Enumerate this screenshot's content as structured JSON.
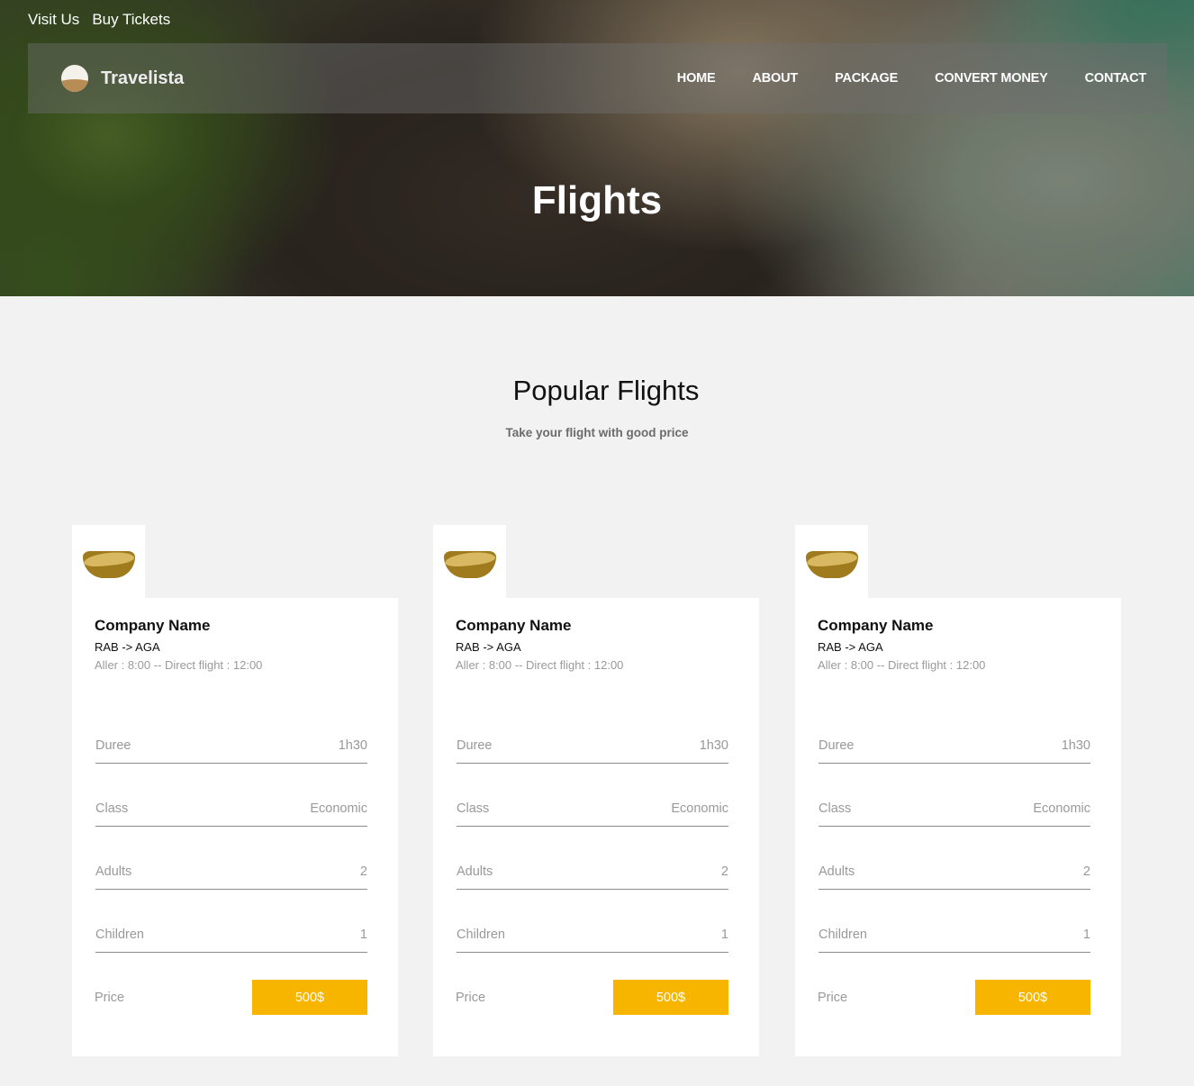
{
  "topbar": {
    "visit": "Visit Us",
    "tickets": "Buy Tickets"
  },
  "brand": {
    "name": "Travelista"
  },
  "nav": [
    "HOME",
    "ABOUT",
    "PACKAGE",
    "CONVERT MONEY",
    "CONTACT"
  ],
  "hero": {
    "title": "Flights"
  },
  "section": {
    "title": "Popular Flights",
    "subtitle": "Take your flight with good price"
  },
  "colors": {
    "accent": "#f8b500",
    "background": "#f2f2f2"
  },
  "cards": [
    {
      "company": "Company Name",
      "route": "RAB -> AGA",
      "times": "Aller : 8:00 -- Direct flight : 12:00",
      "details": [
        {
          "label": "Duree",
          "value": "1h30"
        },
        {
          "label": "Class",
          "value": "Economic"
        },
        {
          "label": "Adults",
          "value": "2"
        },
        {
          "label": "Children",
          "value": "1"
        }
      ],
      "price_label": "Price",
      "price": "500$"
    },
    {
      "company": "Company Name",
      "route": "RAB -> AGA",
      "times": "Aller : 8:00 -- Direct flight : 12:00",
      "details": [
        {
          "label": "Duree",
          "value": "1h30"
        },
        {
          "label": "Class",
          "value": "Economic"
        },
        {
          "label": "Adults",
          "value": "2"
        },
        {
          "label": "Children",
          "value": "1"
        }
      ],
      "price_label": "Price",
      "price": "500$"
    },
    {
      "company": "Company Name",
      "route": "RAB -> AGA",
      "times": "Aller : 8:00 -- Direct flight : 12:00",
      "details": [
        {
          "label": "Duree",
          "value": "1h30"
        },
        {
          "label": "Class",
          "value": "Economic"
        },
        {
          "label": "Adults",
          "value": "2"
        },
        {
          "label": "Children",
          "value": "1"
        }
      ],
      "price_label": "Price",
      "price": "500$"
    }
  ]
}
